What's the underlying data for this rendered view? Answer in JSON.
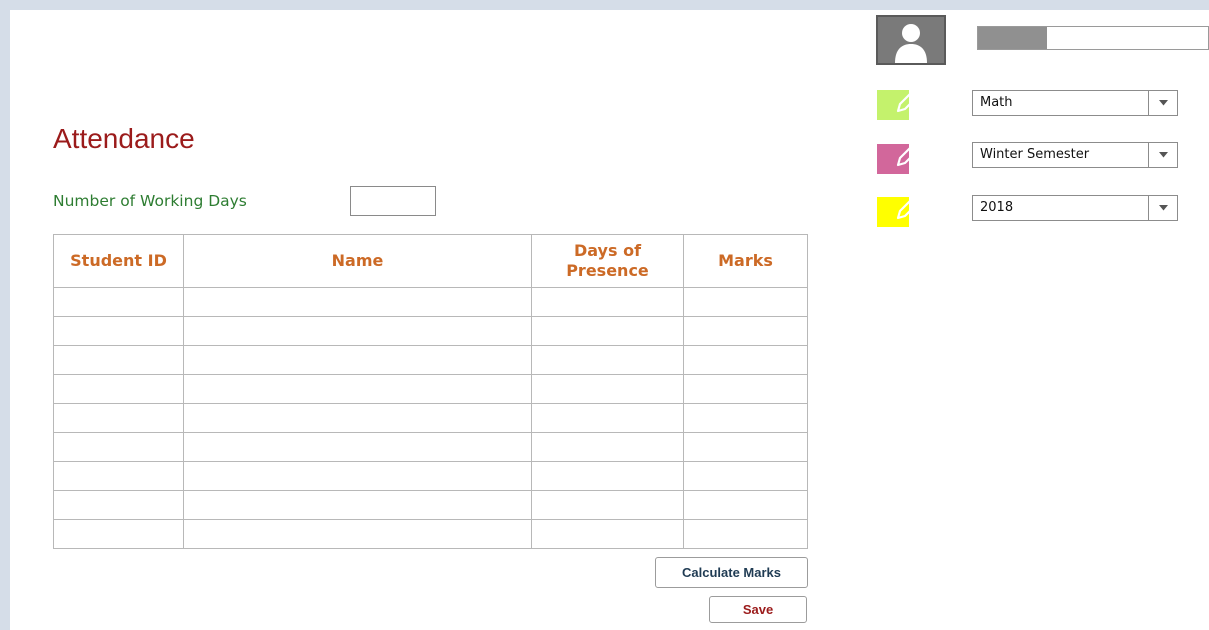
{
  "attendance": {
    "title": "Attendance",
    "working_days_label": "Number of Working Days",
    "working_days_value": ""
  },
  "table": {
    "columns": [
      "Student ID",
      "Name",
      "Days of Presence",
      "Marks"
    ],
    "rows": [
      [
        "",
        "",
        "",
        ""
      ],
      [
        "",
        "",
        "",
        ""
      ],
      [
        "",
        "",
        "",
        ""
      ],
      [
        "",
        "",
        "",
        ""
      ],
      [
        "",
        "",
        "",
        ""
      ],
      [
        "",
        "",
        "",
        ""
      ],
      [
        "",
        "",
        "",
        ""
      ],
      [
        "",
        "",
        "",
        ""
      ],
      [
        "",
        "",
        "",
        ""
      ]
    ]
  },
  "buttons": {
    "calculate": "Calculate Marks",
    "save": "Save"
  },
  "profile": {
    "avatar_icon": "user-silhouette-icon",
    "progress_fraction": 0.3
  },
  "selectors": [
    {
      "icon": "edit-pencil-icon",
      "color": "#c4f26c",
      "value": "Math"
    },
    {
      "icon": "edit-pencil-icon",
      "color": "#d2679b",
      "value": "Winter Semester"
    },
    {
      "icon": "edit-pencil-icon",
      "color": "#ffff00",
      "value": "2018"
    }
  ],
  "colors": {
    "title": "#9b1b1b",
    "label": "#2e7d32",
    "header": "#cc6a26",
    "background": "#d5dde8"
  }
}
